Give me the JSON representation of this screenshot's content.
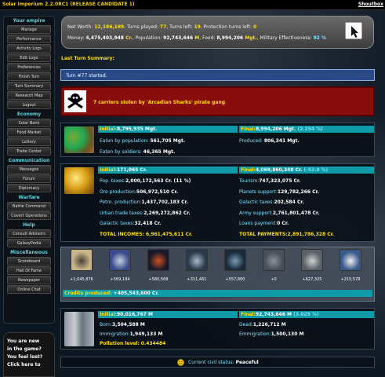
{
  "app": {
    "title": "Solar Imperium 2.2.0RC1 (RELEASE CANDIDATE 1)",
    "shoutbox": "Shoutbox"
  },
  "sidebar": {
    "sections": [
      {
        "header": "Your empire",
        "items": [
          "Manage",
          "Performance",
          "Activity Logs",
          "Edit Logo",
          "Preferences",
          "Finish Turn",
          "Turn Summary",
          "Research Map",
          "Logout"
        ]
      },
      {
        "header": "Economy",
        "items": [
          "Solar Bank",
          "Food Market",
          "Lottery",
          "Trade Center"
        ]
      },
      {
        "header": "Communication",
        "items": [
          "Messages",
          "Forum",
          "Diplomacy"
        ]
      },
      {
        "header": "Warfare",
        "items": [
          "Battle Command",
          "Covert Operations"
        ]
      },
      {
        "header": "Help",
        "items": [
          "Consult Advisors",
          "GalaxyPedia"
        ]
      },
      {
        "header": "Miscellaneous",
        "items": [
          "Scoreboard",
          "Hall Of Fame",
          "Newspaper",
          "Online Chat"
        ]
      }
    ],
    "help_box": [
      "You are new",
      "in the game?",
      "You feel lost?",
      "Click here to"
    ]
  },
  "stats": {
    "net_worth_label": "Net Worth: ",
    "net_worth": "12,186,189",
    "turns_played_label": ", Turns played: ",
    "turns_played": "77",
    "turns_left_label": ", Turns left: ",
    "turns_left": "19",
    "protection_label": ", Protection turns left: ",
    "protection": "0",
    "money_label": "Money: ",
    "money": "4,475,403,948",
    "money_unit": " Cr.",
    "population_label": ", Population: ",
    "population": "92,743,646",
    "population_unit": " M",
    "food_label": ", Food: ",
    "food": "8,994,206",
    "food_unit": " Mgt.",
    "military_label": ", Military Effectiveness: ",
    "military": "92 %"
  },
  "summary": {
    "title": "Last Turn Summary:",
    "turn_started": "Turn #77 started.",
    "pirate_event": "7 carriers stolen by 'Arcadian Sharks' pirate gang",
    "food": {
      "initial_label": "Initial:",
      "initial": "8,795,935 Mgt.",
      "final_label": "Final:",
      "final": "8,994,206 Mgt.",
      "final_pct": " (2.254 %)",
      "eaten_pop_label": "Eaten by population:",
      "eaten_pop": "561,705 Mgt.",
      "produced_label": "Produced:",
      "produced": "806,341 Mgt.",
      "eaten_soldiers_label": "Eaten by soldiers:",
      "eaten_soldiers": "46,365 Mgt."
    },
    "money": {
      "initial_label": "Initial:",
      "initial": "171,065 Cr.",
      "final_label": "Final:",
      "final": "4,069,860,348 Cr.",
      "final_pct": " (-52.0 %)",
      "left": [
        {
          "label": "Pop. taxes:",
          "value": "2,000,172,563 Cr. (11 %)"
        },
        {
          "label": "Ore production:",
          "value": "506,972,510 Cr."
        },
        {
          "label": "Petro. production:",
          "value": "1,437,702,183 Cr."
        },
        {
          "label": "Urban trade taxes:",
          "value": "2,269,272,862 Cr."
        },
        {
          "label": "Galactic taxes:",
          "value": "32,418 Cr."
        }
      ],
      "right": [
        {
          "label": "Tourism:",
          "value": "747,323,075 Cr."
        },
        {
          "label": "Planets support:",
          "value": "129,782,266 Cr."
        },
        {
          "label": "Galactic taxes:",
          "value": "202,584 Cr."
        },
        {
          "label": "Army support:",
          "value": "2,761,801,478 Cr."
        },
        {
          "label": "Loans payment:",
          "value": "0 Cr."
        }
      ],
      "total_incomes_label": "TOTAL INCOMES:",
      "total_incomes": "6,961,475,611 Cr.",
      "total_payments_label": "TOTAL PAYMENTS:",
      "total_payments": "2,891,786,328 Cr."
    },
    "units": {
      "values": [
        "+1,045,876",
        "+569,184",
        "+580,568",
        "+311,461",
        "+557,800",
        "+0",
        "+627,325",
        "+215,578"
      ],
      "credits_label": "Credits produced: ",
      "credits": "+405,543,600 Cr."
    },
    "population": {
      "initial_label": "Initial:",
      "initial": "90,016,767 M",
      "final_label": "Final:",
      "final": "92,743,646 M",
      "final_pct": " (3.029 %)",
      "born_label": "Born:",
      "born": "3,504,588 M",
      "dead_label": "Dead:",
      "dead": "1,226,712 M",
      "immigration_label": "Immigration:",
      "immigration": "1,949,133 M",
      "emigration_label": "Emmigration:",
      "emigration": "1,500,130 M",
      "pollution_label": "Pollution level:",
      "pollution": "0.434484"
    },
    "civil": {
      "label": "Current civil status: ",
      "value": "Peaceful"
    }
  },
  "colors": {
    "accent_cyan": "#0e9aa7",
    "highlight_yellow": "#ffe000",
    "pirate_red": "#8a0d0d"
  },
  "icons": [
    "skull-crossbones-icon",
    "cursor-icon",
    "smiley-icon"
  ]
}
